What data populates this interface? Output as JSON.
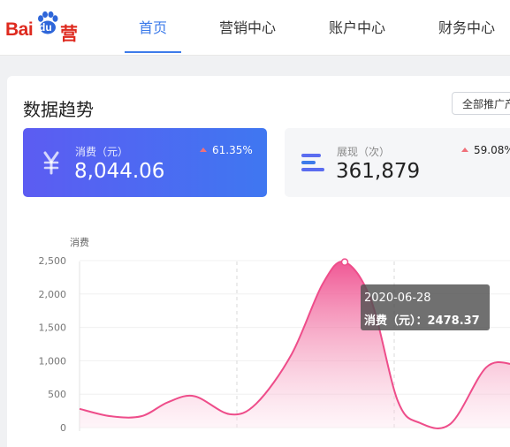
{
  "brand": {
    "logo_text": "Bai du 营",
    "logo_main": "Bai",
    "logo_du": "du",
    "logo_suffix": "营",
    "color": "#de2a1f"
  },
  "nav": {
    "tabs": [
      {
        "label": "首页",
        "active": true
      },
      {
        "label": "营销中心",
        "active": false
      },
      {
        "label": "账户中心",
        "active": false
      },
      {
        "label": "财务中心",
        "active": false
      }
    ],
    "accent": "#3d7bea"
  },
  "panel": {
    "title": "数据趋势",
    "scope_button": "全部推广产品"
  },
  "cards": [
    {
      "label": "消费（元）",
      "value": "8,044.06",
      "change": "61.35%",
      "trend": "up",
      "icon": "yuan-icon"
    },
    {
      "label": "展现（次）",
      "value": "361,879",
      "change": "59.08%",
      "trend": "up",
      "icon": "bars-icon"
    }
  ],
  "chart_data": {
    "type": "area",
    "ylabel": "消费",
    "ylim": [
      0,
      2500
    ],
    "yticks": [
      "2,500",
      "2,000",
      "1,500",
      "1,000",
      "500",
      "0"
    ],
    "series": [
      {
        "name": "消费（元）",
        "color": "#ee4d8a",
        "points": [
          [
            0,
            280
          ],
          [
            0.35,
            170
          ],
          [
            0.7,
            170
          ],
          [
            1,
            380
          ],
          [
            1.3,
            470
          ],
          [
            1.7,
            200
          ],
          [
            2,
            360
          ],
          [
            2.4,
            1100
          ],
          [
            2.75,
            2150
          ],
          [
            3,
            2478.37
          ],
          [
            3.3,
            1900
          ],
          [
            3.6,
            400
          ],
          [
            3.85,
            70
          ],
          [
            4.2,
            60
          ],
          [
            4.6,
            900
          ],
          [
            4.9,
            950
          ]
        ]
      }
    ],
    "tooltip": {
      "date": "2020-06-28",
      "label": "消费（元）：",
      "value": "2478.37"
    }
  }
}
